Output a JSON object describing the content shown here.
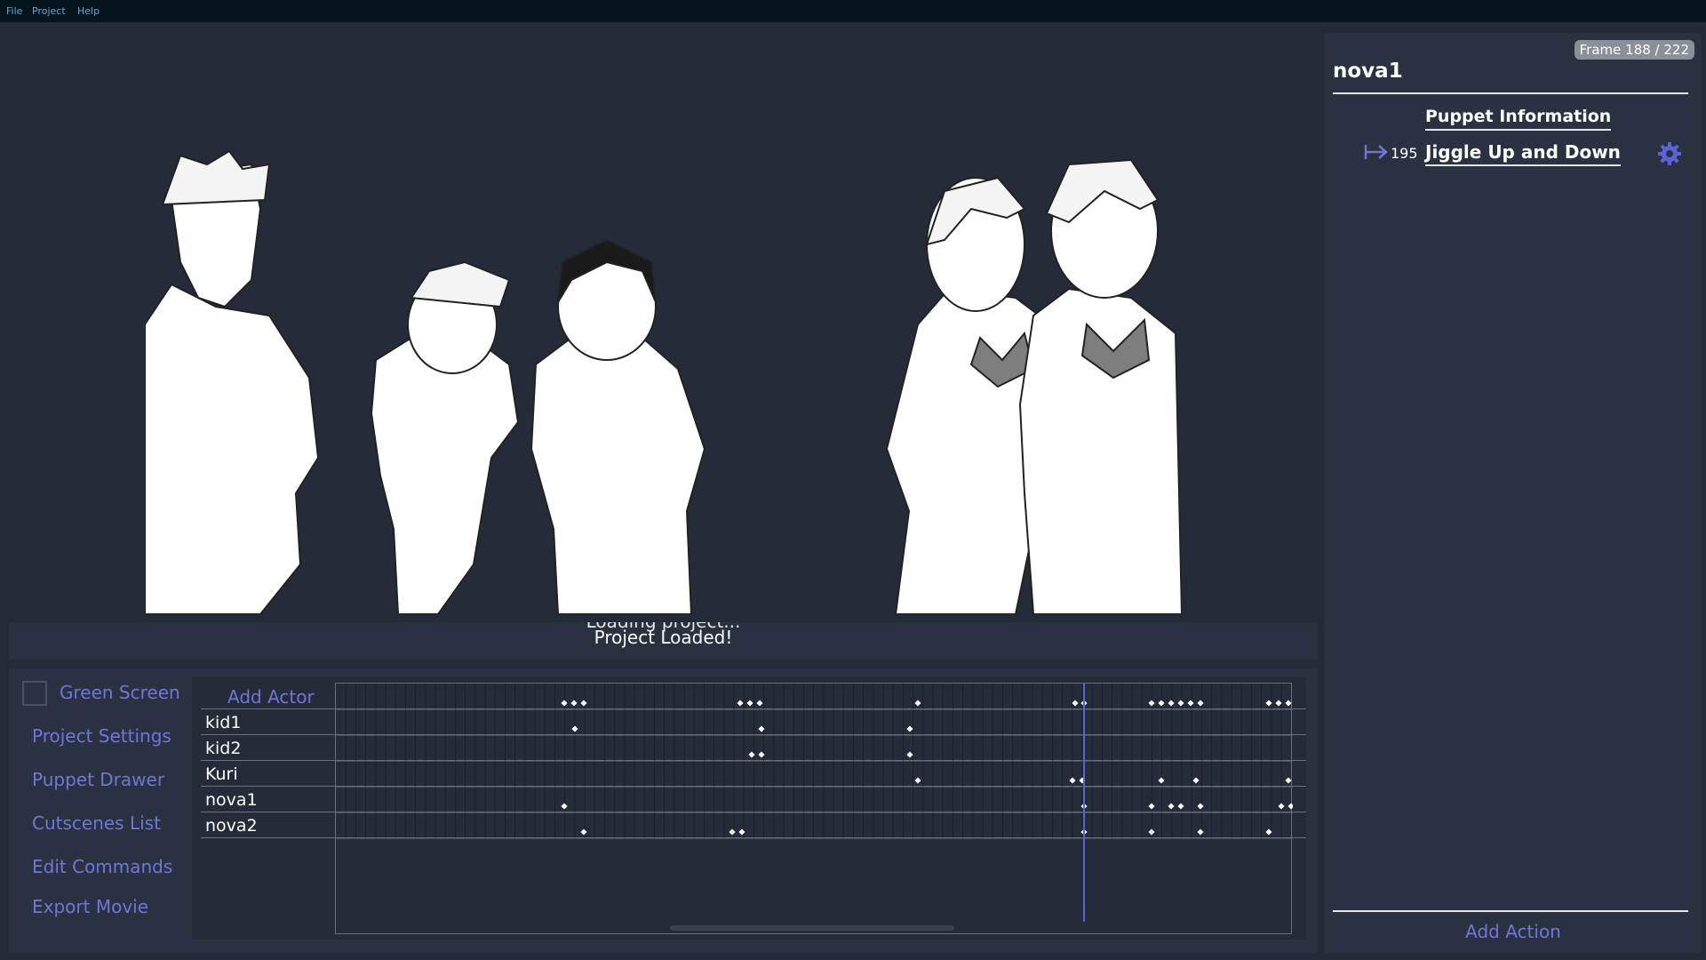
{
  "menu": [
    "File",
    "Project",
    "Help"
  ],
  "status": {
    "previous": "Loading project...",
    "current": "Project Loaded!"
  },
  "left_panel": {
    "green_screen_label": "Green Screen",
    "green_screen_checked": false,
    "links": [
      "Project Settings",
      "Puppet Drawer",
      "Cutscenes List",
      "Edit Commands",
      "Export Movie"
    ]
  },
  "timeline": {
    "add_actor_label": "Add Actor",
    "actors": [
      "kid1",
      "kid2",
      "Kuri",
      "nova1",
      "nova2"
    ],
    "current_frame": 188,
    "total_frames": 222
  },
  "right_panel": {
    "frame_badge": "Frame 188 / 222",
    "puppet_name": "nova1",
    "puppet_info_label": "Puppet Information",
    "action": {
      "frame": "195",
      "name": "Jiggle Up and Down",
      "arrow_icon": "arrow-right-bar-icon",
      "settings_icon": "gear-icon"
    },
    "add_action_label": "Add Action"
  },
  "colors": {
    "accent": "#6f76d8",
    "panel": "#2a3140",
    "background": "#232a38",
    "menubar": "#06141e"
  }
}
